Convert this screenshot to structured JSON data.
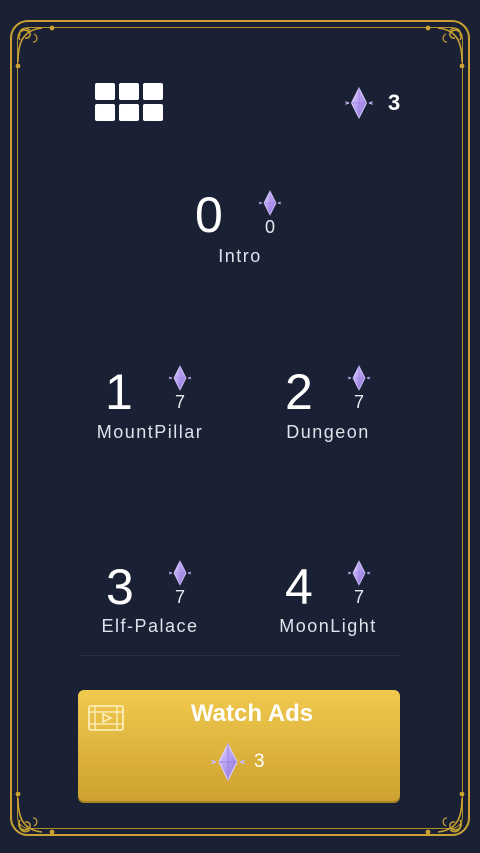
{
  "header": {
    "menu_icon": "grid-menu-icon",
    "gem_icon": "gem-icon",
    "gem_count": "3"
  },
  "levels": [
    {
      "number": "0",
      "cost": "0",
      "name": "Intro"
    },
    {
      "number": "1",
      "cost": "7",
      "name": "MountPillar"
    },
    {
      "number": "2",
      "cost": "7",
      "name": "Dungeon"
    },
    {
      "number": "3",
      "cost": "7",
      "name": "Elf-Palace"
    },
    {
      "number": "4",
      "cost": "7",
      "name": "MoonLight"
    }
  ],
  "watch_ads": {
    "label": "Watch Ads",
    "icon": "video-icon",
    "reward_icon": "gem-icon",
    "reward": "3"
  },
  "colors": {
    "background": "#1b2134",
    "frame_gold": "#c9a233",
    "button_gold": "#e3b940",
    "gem_purple": "#b49cf0"
  }
}
